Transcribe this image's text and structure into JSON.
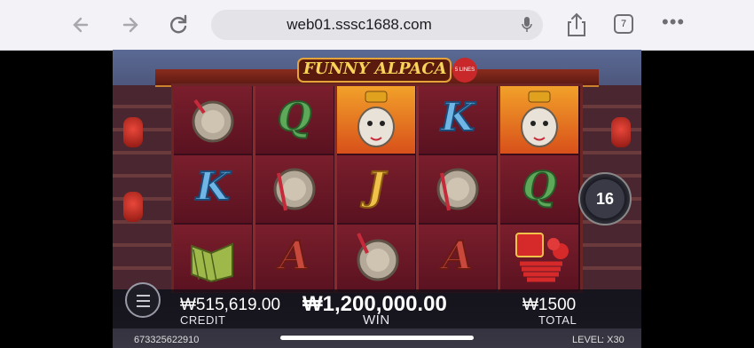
{
  "browser": {
    "url": "web01.sssc1688.com",
    "tab_count": "7",
    "icons": [
      "back-icon",
      "forward-icon",
      "reload-icon",
      "mic-icon",
      "share-icon",
      "tabs-icon",
      "more-icon"
    ]
  },
  "game": {
    "title": "FUNNY ALPACA",
    "lines_badge": "5 LINES",
    "reels": [
      [
        "gong",
        "K",
        "banner"
      ],
      [
        "Q",
        "gong",
        "A"
      ],
      [
        "alpaca",
        "J",
        "gong"
      ],
      [
        "K",
        "gong",
        "A"
      ],
      [
        "alpaca",
        "Q",
        "firecracker"
      ]
    ],
    "spin_count": "16",
    "credit_value": "₩515,619.00",
    "credit_label": "CREDIT",
    "win_value": "₩1,200,000.00",
    "win_label": "WIN",
    "total_value": "₩1500",
    "total_label": "TOTAL",
    "account_id": "673325622910",
    "level_label": "LEVEL",
    "level_value": ": X30",
    "colors": {
      "bet_bar": "#1c1c26",
      "reel_bg": "#6a1626",
      "accent_gold": "#f1c24a"
    }
  }
}
